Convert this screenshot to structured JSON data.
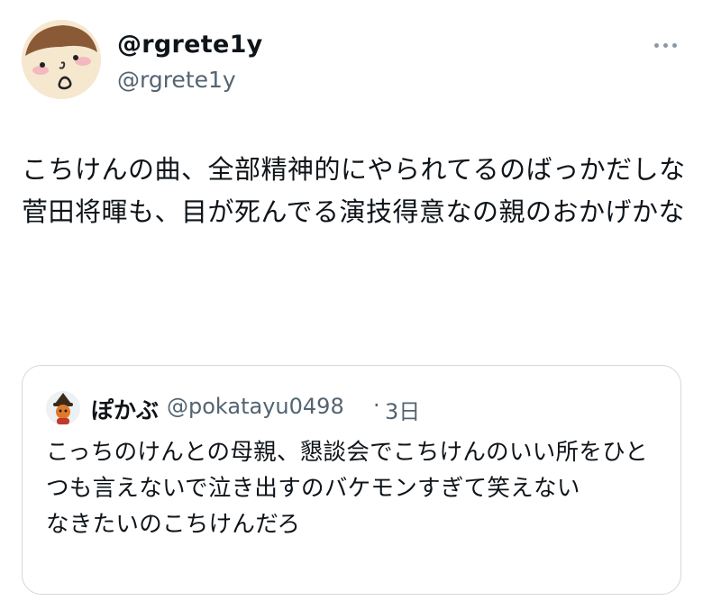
{
  "tweet": {
    "display_name": "@rgrete1y",
    "handle": "@rgrete1y",
    "avatar_icon": "cartoon-face-avatar",
    "more_icon": "more-options-icon",
    "text": "こちけんの曲、全部精神的にやられてるのばっかだしな\n菅田将暉も、目が死んでる演技得意なの親のおかげかな"
  },
  "quoted_tweet": {
    "display_name": "ぽかぶ",
    "handle": "@pokatayu0498",
    "separator": "·",
    "time": "3日",
    "avatar_icon": "character-avatar",
    "text": "こっちのけんとの母親、懇談会でこちけんのいい所をひとつも言えないで泣き出すのバケモンすぎて笑えない\nなきたいのこちけんだろ"
  },
  "colors": {
    "text_primary": "#0f1419",
    "text_secondary": "#536471",
    "border": "#cfd9de"
  }
}
